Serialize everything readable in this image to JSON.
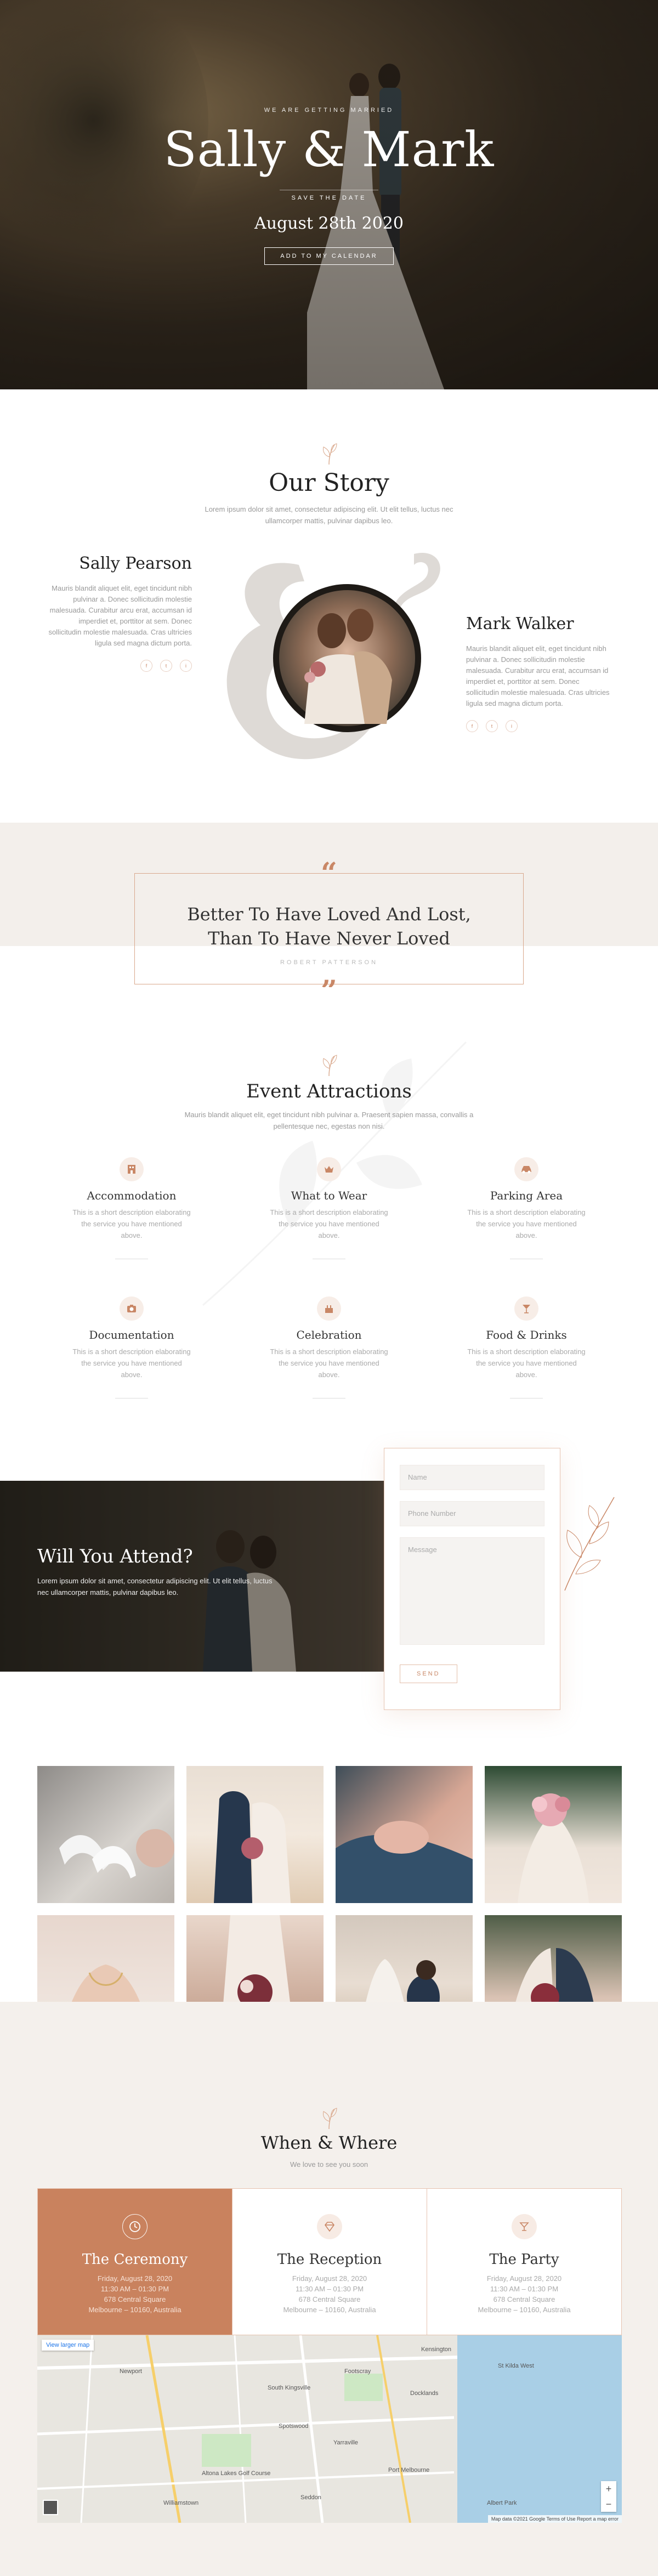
{
  "hero": {
    "eyebrow": "We are getting married",
    "names": "Sally & Mark",
    "save_the_date": "Save the date",
    "date": "August 28th 2020",
    "calendar_button": "Add to my calendar"
  },
  "story": {
    "title": "Our Story",
    "subtitle": "Lorem ipsum dolor sit amet, consectetur adipiscing elit. Ut elit tellus, luctus nec ullamcorper mattis, pulvinar dapibus leo.",
    "bride": {
      "name": "Sally Pearson",
      "bio": "Mauris blandit aliquet elit, eget tincidunt nibh pulvinar a. Donec sollicitudin molestie malesuada. Curabitur arcu erat, accumsan id imperdiet et, porttitor at sem. Donec sollicitudin molestie malesuada. Cras ultricies ligula sed magna dictum porta.",
      "socials": [
        "f",
        "t",
        "i"
      ]
    },
    "groom": {
      "name": "Mark Walker",
      "bio": "Mauris blandit aliquet elit, eget tincidunt nibh pulvinar a. Donec sollicitudin molestie malesuada. Curabitur arcu erat, accumsan id imperdiet et, porttitor at sem. Donec sollicitudin molestie malesuada. Cras ultricies ligula sed magna dictum porta.",
      "socials": [
        "f",
        "t",
        "i"
      ]
    }
  },
  "quote": {
    "open_mark": "“",
    "close_mark": "”",
    "line1": "Better To Have Loved And Lost,",
    "line2": "Than To Have Never Loved",
    "author": "Robert Patterson"
  },
  "events": {
    "title": "Event Attractions",
    "subtitle": "Mauris blandit aliquet elit, eget tincidunt nibh pulvinar a. Praesent sapien massa, convallis a pellentesque nec, egestas non nisi.",
    "items": [
      {
        "title": "Accommodation",
        "desc": "This is a short description elaborating the service you have mentioned above.",
        "icon": "hotel-icon"
      },
      {
        "title": "What to Wear",
        "desc": "This is a short description elaborating the service you have mentioned above.",
        "icon": "crown-icon"
      },
      {
        "title": "Parking Area",
        "desc": "This is a short description elaborating the service you have mentioned above.",
        "icon": "car-icon"
      },
      {
        "title": "Documentation",
        "desc": "This is a short description elaborating the service you have mentioned above.",
        "icon": "camera-icon"
      },
      {
        "title": "Celebration",
        "desc": "This is a short description elaborating the service you have mentioned above.",
        "icon": "cake-icon"
      },
      {
        "title": "Food & Drinks",
        "desc": "This is a short description elaborating the service you have mentioned above.",
        "icon": "cocktail-icon"
      }
    ]
  },
  "rsvp": {
    "title": "Will You Attend?",
    "text": "Lorem ipsum dolor sit amet, consectetur adipiscing elit. Ut elit tellus, luctus nec ullamcorper mattis, pulvinar dapibus leo.",
    "name_placeholder": "Name",
    "phone_placeholder": "Phone Number",
    "message_placeholder": "Message",
    "send_label": "Send"
  },
  "when_where": {
    "title": "When & Where",
    "subtitle": "We love to see you soon",
    "cards": [
      {
        "title": "The Ceremony",
        "date": "Friday, August 28, 2020",
        "time": "11:30 AM – 01:30 PM",
        "street": "678 Central Square",
        "city": "Melbourne – 10160, Australia",
        "icon": "clock-icon"
      },
      {
        "title": "The Reception",
        "date": "Friday, August 28, 2020",
        "time": "11:30 AM – 01:30 PM",
        "street": "678 Central Square",
        "city": "Melbourne – 10160, Australia",
        "icon": "diamond-icon"
      },
      {
        "title": "The Party",
        "date": "Friday, August 28, 2020",
        "time": "11:30 AM – 01:30 PM",
        "street": "678 Central Square",
        "city": "Melbourne – 10160, Australia",
        "icon": "cocktail-icon"
      }
    ]
  },
  "map": {
    "view_larger": "View larger map",
    "labels": [
      "Kensington",
      "Docklands",
      "Altona Lakes Golf Course",
      "Port Melbourne",
      "Williamstown",
      "South Kingsville",
      "Newport",
      "Spotswood",
      "Yarraville",
      "Seddon",
      "Footscray",
      "Albert Park",
      "St Kilda West"
    ],
    "zoom_in": "+",
    "zoom_out": "−",
    "attribution": "Map data ©2021 Google   Terms of Use   Report a map error"
  },
  "colors": {
    "accent": "#c98766",
    "card_active": "#c9825e",
    "band": "#f3efeb"
  }
}
